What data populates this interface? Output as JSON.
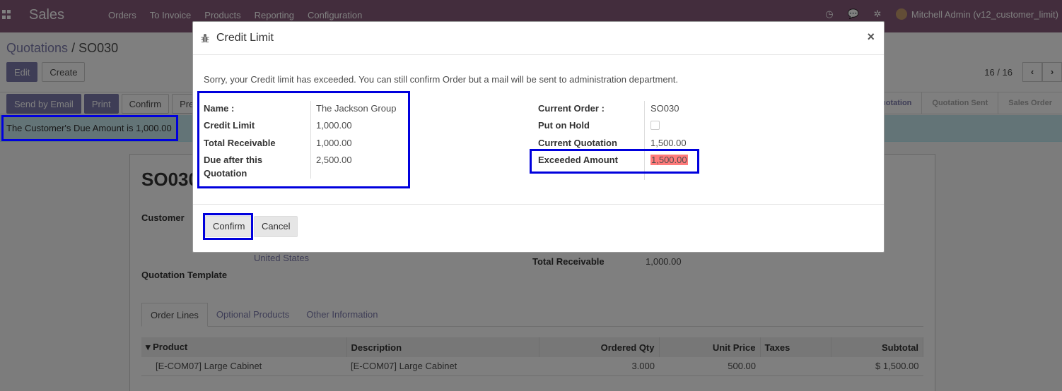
{
  "navbar": {
    "app_name": "Sales",
    "menu": [
      "Orders",
      "To Invoice",
      "Products",
      "Reporting",
      "Configuration"
    ],
    "user": "Mitchell Admin (v12_customer_limit)",
    "icons": [
      "clock-icon",
      "chat-icon",
      "bug-icon"
    ]
  },
  "breadcrumb": {
    "parent": "Quotations",
    "separator": "/",
    "current": "SO030"
  },
  "control_panel": {
    "edit_label": "Edit",
    "create_label": "Create",
    "pager": "16 / 16"
  },
  "statusbar": {
    "buttons": [
      "Send by Email",
      "Print",
      "Confirm",
      "Prev"
    ],
    "stages": [
      "Quotation",
      "Quotation Sent",
      "Sales Order"
    ]
  },
  "alert": {
    "text": "The Customer's Due Amount is 1,000.00"
  },
  "form": {
    "title": "SO030",
    "customer_label": "Customer",
    "country": "United States",
    "template_label": "Quotation Template",
    "total_receivable_label": "Total Receivable",
    "total_receivable_value": "1,000.00",
    "tabs": [
      "Order Lines",
      "Optional Products",
      "Other Information"
    ],
    "table": {
      "headers": [
        "Product",
        "Description",
        "Ordered Qty",
        "Unit Price",
        "Taxes",
        "Subtotal"
      ],
      "rows": [
        {
          "product": "[E-COM07] Large Cabinet",
          "description": "[E-COM07] Large Cabinet",
          "qty": "3.000",
          "price": "500.00",
          "taxes": "",
          "subtotal": "$ 1,500.00"
        }
      ]
    }
  },
  "modal": {
    "title": "Credit Limit",
    "close": "×",
    "message": "Sorry, your Credit limit has exceeded. You can still confirm Order but a mail will be sent to administration department.",
    "left": {
      "name_label": "Name :",
      "name_value": "The Jackson Group",
      "credit_label": "Credit Limit",
      "credit_value": "1,000.00",
      "receivable_label": "Total Receivable",
      "receivable_value": "1,000.00",
      "due_label": "Due after this Quotation",
      "due_value": "2,500.00"
    },
    "right": {
      "order_label": "Current Order :",
      "order_value": "SO030",
      "hold_label": "Put on Hold",
      "hold_checked": false,
      "quotation_label": "Current Quotation",
      "quotation_value": "1,500.00",
      "exceeded_label": "Exceeded Amount",
      "exceeded_value": "1,500.00"
    },
    "confirm_label": "Confirm",
    "cancel_label": "Cancel"
  },
  "colors": {
    "brand": "#875a7b",
    "primary": "#7c7bad",
    "highlight": "#0000dd",
    "danger": "#ff7b7b"
  }
}
